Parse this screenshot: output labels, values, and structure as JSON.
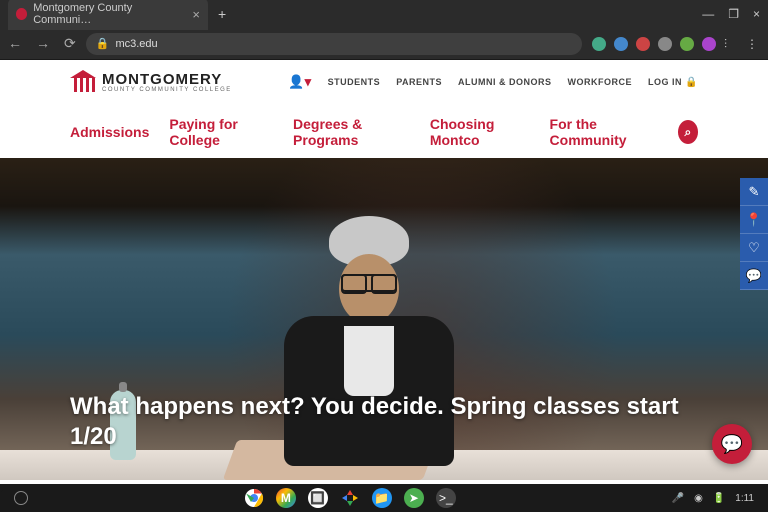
{
  "browser": {
    "tab_title": "Montgomery County Communi…",
    "url": "mc3.edu"
  },
  "logo": {
    "main": "MONTGOMERY",
    "sub": "COUNTY COMMUNITY COLLEGE"
  },
  "util_nav": {
    "students": "STUDENTS",
    "parents": "PARENTS",
    "alumni": "ALUMNI & DONORS",
    "workforce": "WORKFORCE",
    "login": "LOG IN"
  },
  "main_nav": {
    "admissions": "Admissions",
    "paying": "Paying for College",
    "degrees": "Degrees & Programs",
    "choosing": "Choosing Montco",
    "community": "For the Community"
  },
  "hero": {
    "headline": "What happens next? You decide. Spring classes start 1/20"
  },
  "taskbar": {
    "time": "1:11"
  },
  "colors": {
    "brand_red": "#c41e3a",
    "side_blue": "#2a5cad"
  }
}
